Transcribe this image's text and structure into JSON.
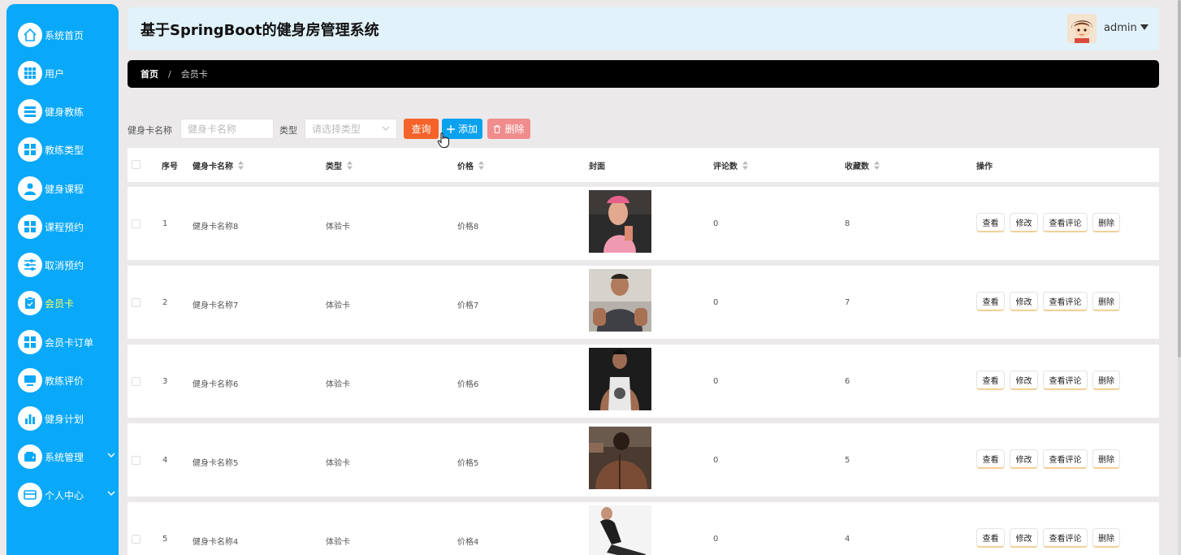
{
  "sidebar": {
    "items": [
      {
        "label": "系统首页",
        "icon": "home-icon"
      },
      {
        "label": "用户",
        "icon": "grid-icon"
      },
      {
        "label": "健身教练",
        "icon": "list-icon"
      },
      {
        "label": "教练类型",
        "icon": "grid-icon"
      },
      {
        "label": "健身课程",
        "icon": "user-icon"
      },
      {
        "label": "课程预约",
        "icon": "grid-icon"
      },
      {
        "label": "取消预约",
        "icon": "sliders-icon"
      },
      {
        "label": "会员卡",
        "icon": "clipboard-icon",
        "active": true
      },
      {
        "label": "会员卡订单",
        "icon": "grid-icon"
      },
      {
        "label": "教练评价",
        "icon": "monitor-icon"
      },
      {
        "label": "健身计划",
        "icon": "bar-chart-icon"
      },
      {
        "label": "系统管理",
        "icon": "wallet-icon",
        "expandable": true
      },
      {
        "label": "个人中心",
        "icon": "card-icon",
        "expandable": true
      }
    ]
  },
  "header": {
    "title": "基于SpringBoot的健身房管理系统",
    "user": "admin"
  },
  "breadcrumb": {
    "home": "首页",
    "separator": "/",
    "current": "会员卡"
  },
  "search": {
    "name_label": "健身卡名称",
    "name_placeholder": "健身卡名称",
    "type_label": "类型",
    "type_placeholder": "请选择类型",
    "query_label": "查询",
    "add_label": "添加",
    "delete_label": "删除"
  },
  "table": {
    "headers": {
      "index": "序号",
      "name": "健身卡名称",
      "type": "类型",
      "price": "价格",
      "cover": "封面",
      "comments": "评论数",
      "favorites": "收藏数",
      "actions": "操作"
    },
    "actions": {
      "view": "查看",
      "edit": "修改",
      "view_comments": "查看评论",
      "delete": "删除"
    },
    "rows": [
      {
        "index": "1",
        "name": "健身卡名称8",
        "type": "体验卡",
        "price": "价格8",
        "comments": "0",
        "favorites": "8"
      },
      {
        "index": "2",
        "name": "健身卡名称7",
        "type": "体验卡",
        "price": "价格7",
        "comments": "0",
        "favorites": "7"
      },
      {
        "index": "3",
        "name": "健身卡名称6",
        "type": "体验卡",
        "price": "价格6",
        "comments": "0",
        "favorites": "6"
      },
      {
        "index": "4",
        "name": "健身卡名称5",
        "type": "体验卡",
        "price": "价格5",
        "comments": "0",
        "favorites": "5"
      },
      {
        "index": "5",
        "name": "健身卡名称4",
        "type": "体验卡",
        "price": "价格4",
        "comments": "0",
        "favorites": "4"
      }
    ]
  },
  "colors": {
    "sidebar": "#0aa8f8",
    "query": "#f5632a",
    "add": "#0aa2ee",
    "delete": "#f08c8c",
    "active_label": "#ffff5a"
  }
}
